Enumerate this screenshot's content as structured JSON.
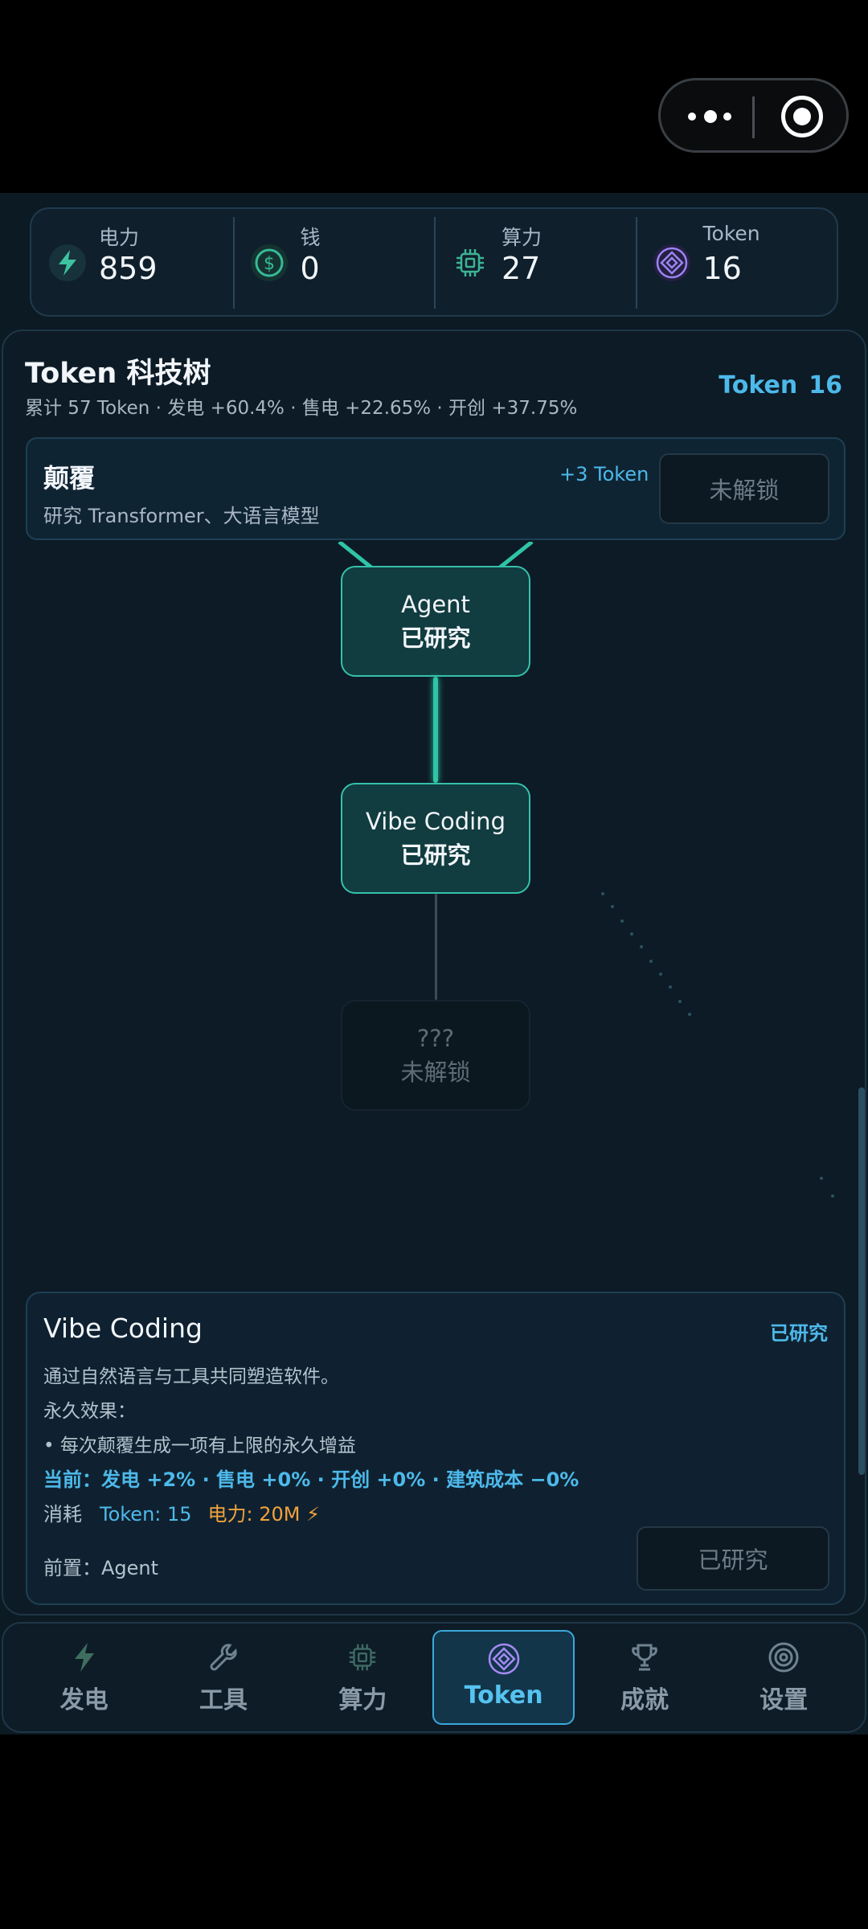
{
  "resources": [
    {
      "label": "电力",
      "value": "859",
      "icon": "lightning-icon"
    },
    {
      "label": "钱",
      "value": "0",
      "icon": "dollar-icon"
    },
    {
      "label": "算力",
      "value": "27",
      "icon": "chip-icon"
    },
    {
      "label": "Token",
      "value": "16",
      "icon": "token-icon"
    }
  ],
  "panel": {
    "title": "Token 科技树",
    "subtitle": "累计 57 Token · 发电 +60.4% · 售电 +22.65% · 开创 +37.75%",
    "token_label": "Token",
    "token_value": "16"
  },
  "overturn": {
    "title": "颠覆",
    "desc": "研究 Transformer、大语言模型",
    "bonus": "+3 Token",
    "button": "未解锁"
  },
  "tree": {
    "nodes": [
      {
        "name": "Agent",
        "status": "已研究"
      },
      {
        "name": "Vibe Coding",
        "status": "已研究"
      },
      {
        "name": "???",
        "status": "未解锁"
      }
    ]
  },
  "detail": {
    "title": "Vibe Coding",
    "status": "已研究",
    "desc": "通过自然语言与工具共同塑造软件。",
    "effect_header": "永久效果：",
    "effect_item": "• 每次颠覆生成一项有上限的永久增益",
    "current": "当前：发电 +2% · 售电 +0% · 开创 +0% · 建筑成本 −0%",
    "cost_label": "消耗",
    "cost_token": "Token: 15",
    "cost_power": "电力: 20M ⚡",
    "prereq": "前置：Agent",
    "button": "已研究"
  },
  "nav": [
    {
      "label": "发电",
      "icon": "lightning-icon",
      "active": false
    },
    {
      "label": "工具",
      "icon": "wrench-icon",
      "active": false
    },
    {
      "label": "算力",
      "icon": "chip-icon",
      "active": false
    },
    {
      "label": "Token",
      "icon": "token-icon",
      "active": true
    },
    {
      "label": "成就",
      "icon": "trophy-icon",
      "active": false
    },
    {
      "label": "设置",
      "icon": "gear-icon",
      "active": false
    }
  ],
  "colors": {
    "accent": "#4db9ea",
    "researched_border": "#35c1a9",
    "power_cost": "#f3a33c"
  }
}
